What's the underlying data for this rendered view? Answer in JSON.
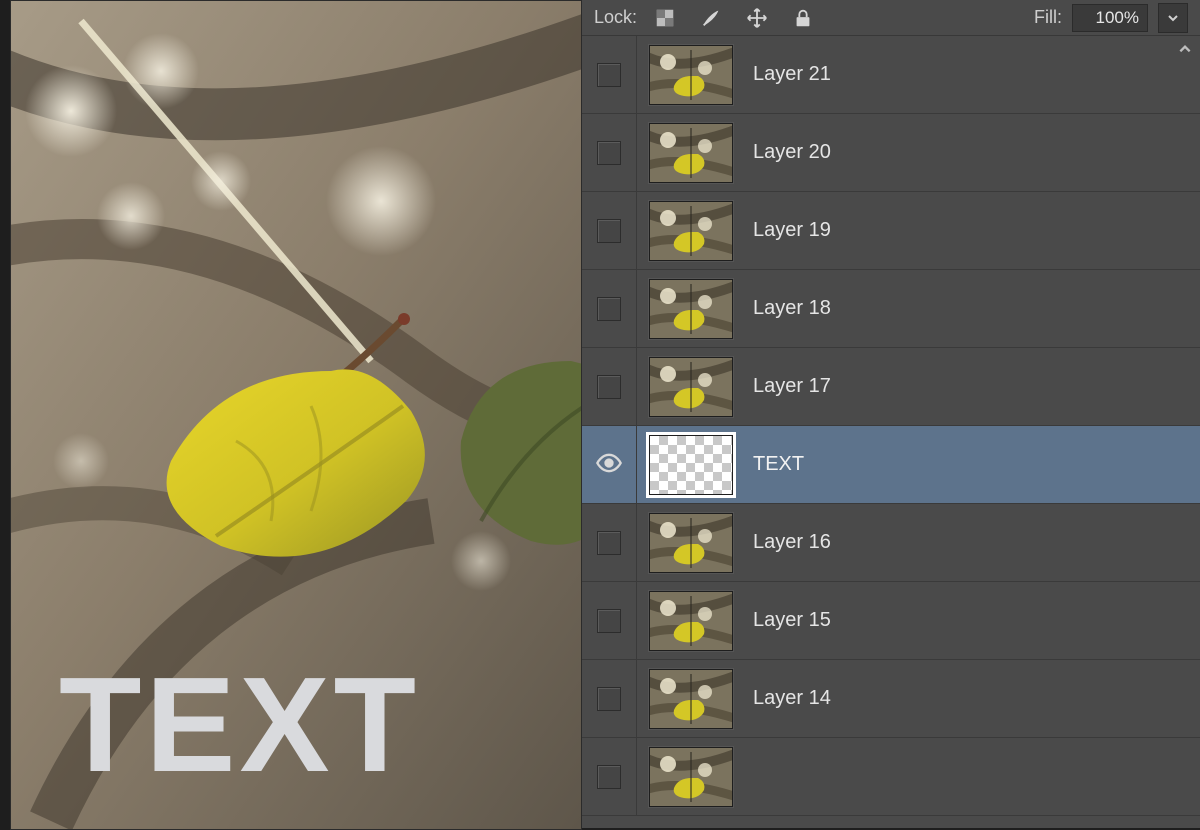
{
  "canvas": {
    "overlay_text": "TEXT"
  },
  "panel": {
    "lock_label": "Lock:",
    "fill_label": "Fill:",
    "fill_value": "100%",
    "icons": {
      "transparency": "lock-transparency-icon",
      "brush": "brush-icon",
      "move": "move-icon",
      "lock": "lock-icon",
      "dropdown": "chevron-down-icon"
    }
  },
  "layers": [
    {
      "name": "Layer 21",
      "visible": false,
      "selected": false,
      "thumb": "photo"
    },
    {
      "name": "Layer 20",
      "visible": false,
      "selected": false,
      "thumb": "photo"
    },
    {
      "name": "Layer 19",
      "visible": false,
      "selected": false,
      "thumb": "photo"
    },
    {
      "name": "Layer 18",
      "visible": false,
      "selected": false,
      "thumb": "photo"
    },
    {
      "name": "Layer 17",
      "visible": false,
      "selected": false,
      "thumb": "photo"
    },
    {
      "name": "TEXT",
      "visible": true,
      "selected": true,
      "thumb": "checker"
    },
    {
      "name": "Layer 16",
      "visible": false,
      "selected": false,
      "thumb": "photo"
    },
    {
      "name": "Layer 15",
      "visible": false,
      "selected": false,
      "thumb": "photo"
    },
    {
      "name": "Layer 14",
      "visible": false,
      "selected": false,
      "thumb": "photo"
    },
    {
      "name": "",
      "visible": false,
      "selected": false,
      "thumb": "photo"
    }
  ]
}
